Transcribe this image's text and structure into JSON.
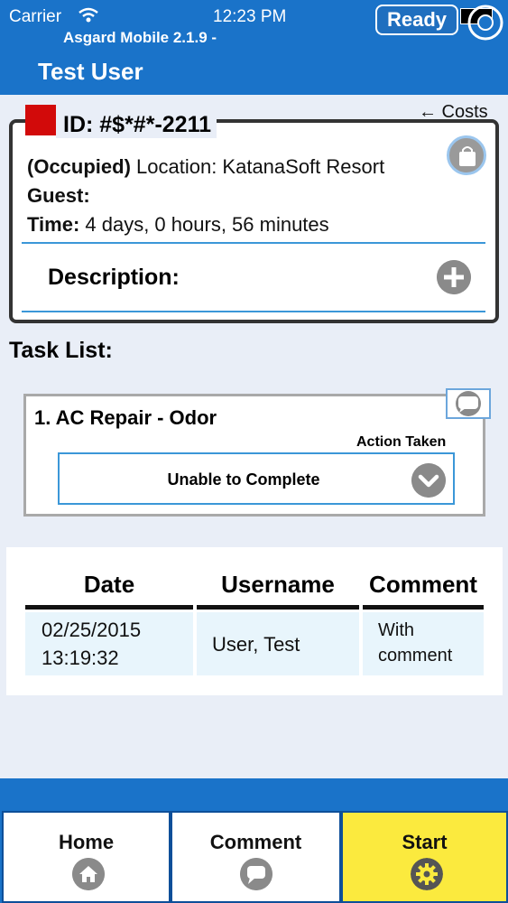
{
  "status_bar": {
    "carrier": "Carrier",
    "time": "12:23 PM"
  },
  "header": {
    "ready_label": "Ready",
    "app_version": "Asgard Mobile 2.1.9 -",
    "user": "Test User"
  },
  "details": {
    "costs_link": "← Costs",
    "id": "ID: #$*#*-2211",
    "occupied_label": "(Occupied)",
    "location_text": " Location: KatanaSoft Resort",
    "guest_label": "Guest:",
    "time_label": "Time:",
    "time_value": " 4 days, 0 hours, 56 minutes",
    "description_label": "Description:",
    "flag_color": "#d20a0a"
  },
  "task_list": {
    "heading": "Task List:",
    "tasks": [
      {
        "title": "1. AC Repair - Odor",
        "action_label": "Action Taken",
        "action_value": "Unable to Complete"
      }
    ]
  },
  "history": {
    "columns": [
      "Date",
      "Username",
      "Comment"
    ],
    "rows": [
      {
        "date_line1": "02/25/2015",
        "date_line2": "13:19:32",
        "username": "User, Test",
        "comment_line1": "With",
        "comment_line2": "comment"
      }
    ]
  },
  "nav": {
    "items": [
      {
        "label": "Home",
        "icon": "home-icon"
      },
      {
        "label": "Comment",
        "icon": "speech-bubble-icon"
      },
      {
        "label": "Start",
        "icon": "gear-icon",
        "active": true
      }
    ]
  },
  "colors": {
    "header_blue": "#1a73c9",
    "accent_blue": "#3b97d8",
    "active_tab": "#fbea3e"
  }
}
